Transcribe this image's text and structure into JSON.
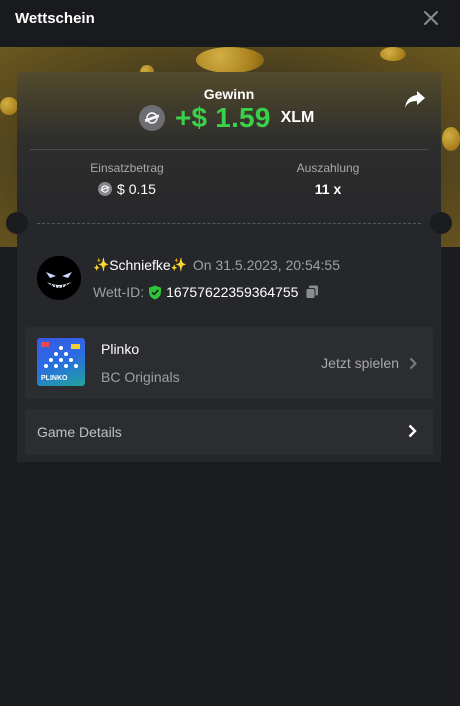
{
  "header": {
    "title": "Wettschein"
  },
  "result": {
    "label": "Gewinn",
    "amount": "+$ 1.59",
    "currency": "XLM"
  },
  "stats": {
    "bet_label": "Einsatzbetrag",
    "bet_value": "$ 0.15",
    "payout_label": "Auszahlung",
    "payout_value": "11 x"
  },
  "user": {
    "spark_left": "✨",
    "name": "Schniefke",
    "spark_right": "✨",
    "date": "On 31.5.2023, 20:54:55",
    "bet_id_label": "Wett-ID:",
    "bet_id": "16757622359364755"
  },
  "game": {
    "name": "Plinko",
    "provider": "BC Originals",
    "play_label": "Jetzt spielen",
    "thumb_text": "PLINKO"
  },
  "details": {
    "label": "Game Details"
  },
  "colors": {
    "accent_green": "#3ad04a",
    "background": "#1b1c1f",
    "card": "#26272b"
  }
}
